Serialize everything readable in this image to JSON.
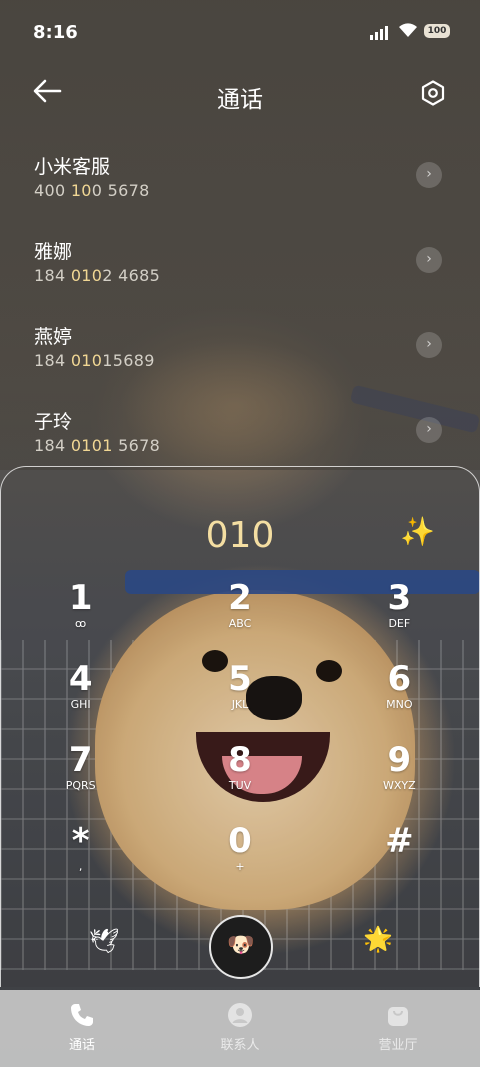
{
  "status": {
    "time": "8:16",
    "battery": "100"
  },
  "header": {
    "title": "通话"
  },
  "contacts": [
    {
      "name": "小米客服",
      "num_parts": [
        "400 ",
        "10",
        "0 5678"
      ]
    },
    {
      "name": "雅娜",
      "num_parts": [
        "184 ",
        "010",
        "2 4685"
      ]
    },
    {
      "name": "燕婷",
      "num_parts": [
        "184 ",
        "010",
        "15689"
      ]
    },
    {
      "name": "子玲",
      "num_parts": [
        "184 ",
        "0101",
        " 5678"
      ]
    }
  ],
  "dialer": {
    "entered": "010",
    "keys": [
      {
        "digit": "1",
        "letters": "ꝏ"
      },
      {
        "digit": "2",
        "letters": "ABC"
      },
      {
        "digit": "3",
        "letters": "DEF"
      },
      {
        "digit": "4",
        "letters": "GHI"
      },
      {
        "digit": "5",
        "letters": "JKL"
      },
      {
        "digit": "6",
        "letters": "MNO"
      },
      {
        "digit": "7",
        "letters": "PQRS"
      },
      {
        "digit": "8",
        "letters": "TUV"
      },
      {
        "digit": "9",
        "letters": "WXYZ"
      },
      {
        "digit": "*",
        "letters": ","
      },
      {
        "digit": "0",
        "letters": "+"
      },
      {
        "digit": "#",
        "letters": ""
      }
    ]
  },
  "nav": {
    "calls": "通话",
    "contacts": "联系人",
    "store": "营业厅"
  },
  "colors": {
    "highlight": "#f1d794",
    "entered": "#f4dea2"
  }
}
